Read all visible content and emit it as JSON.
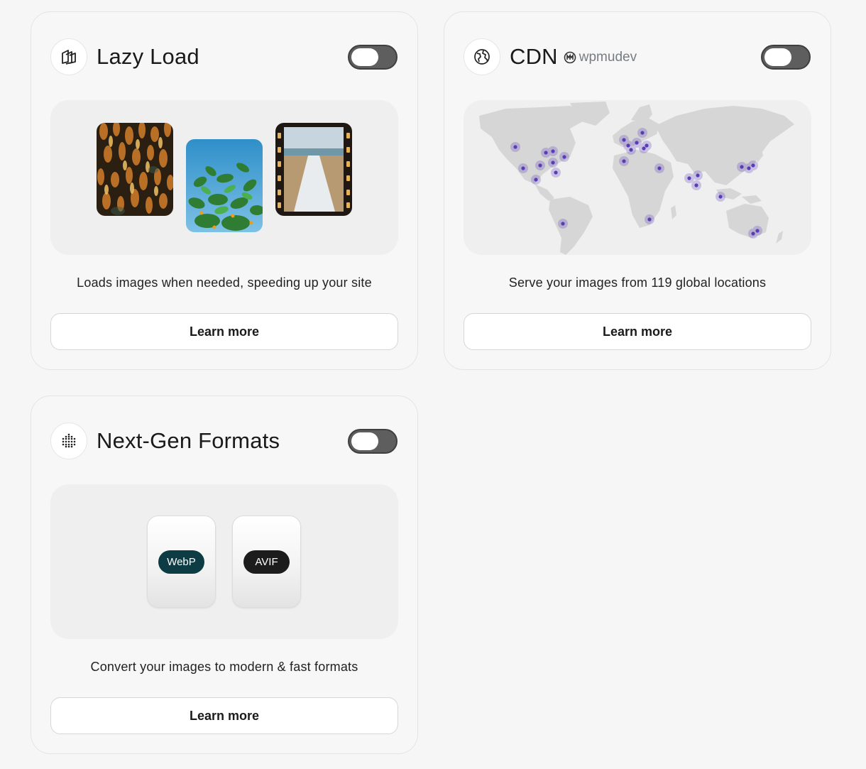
{
  "cards": {
    "lazy_load": {
      "title": "Lazy Load",
      "icon": "lazy-load-icon",
      "toggle_on": false,
      "description": "Loads images when needed, speeding up your site",
      "button_label": "Learn more"
    },
    "cdn": {
      "title": "CDN",
      "brand_name": "wpmudev",
      "icon": "globe-icon",
      "toggle_on": false,
      "description": "Serve your images from 119 global locations",
      "button_label": "Learn more"
    },
    "next_gen": {
      "title": "Next-Gen Formats",
      "icon": "dots-grid-icon",
      "toggle_on": false,
      "description": "Convert your images to modern & fast formats",
      "button_label": "Learn more",
      "formats": [
        {
          "label": "WebP",
          "color": "#0d3c45"
        },
        {
          "label": "AVIF",
          "color": "#1c1c1c"
        }
      ]
    }
  },
  "colors": {
    "toggle_off": "#5e5e5e",
    "map_land": "#d6d6d6",
    "map_marker": "#5a3bb8"
  }
}
